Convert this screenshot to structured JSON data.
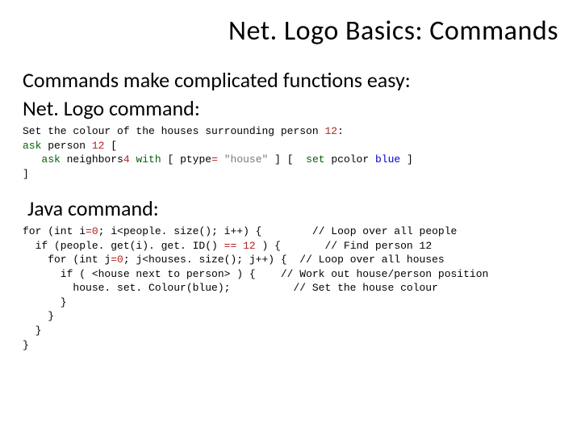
{
  "title": "Net. Logo Basics: Commands",
  "intro_line1": "Commands make complicated functions easy:",
  "intro_line2": " Net. Logo command:",
  "netlogo": {
    "l1_a": "Set the colour of the houses surrounding person ",
    "l1_num": "12",
    "l1_b": ":",
    "l2_a": "ask",
    "l2_b": " person ",
    "l2_num": "12",
    "l2_c": " [",
    "l3_a": "   ",
    "l3_ask": "ask",
    "l3_b": " neighbors",
    "l3_num4": "4",
    "l3_c": " ",
    "l3_with": "with",
    "l3_d": " [ ptype",
    "l3_eq": "=",
    "l3_e": " ",
    "l3_str": "\"house\"",
    "l3_f": " ] [  ",
    "l3_set": "set",
    "l3_g": " pcolor ",
    "l3_blue": "blue",
    "l3_h": " ]",
    "l4": "]"
  },
  "java_label": "Java command:",
  "java": {
    "l1_a": "for (int i",
    "l1_eq": "=",
    "l1_z": "0",
    "l1_b": "; i<people. size(); i++) {        ",
    "c1": "// Loop over all people",
    "l2_a": "  if (people. get(i). get. ID() ",
    "l2_eq": "==",
    "l2_b": " ",
    "l2_n": "12",
    "l2_c": " ) {       ",
    "c2": "// Find person 12",
    "l3_a": "    for (int j",
    "l3_eq": "=",
    "l3_z": "0",
    "l3_b": "; j<houses. size(); j++) {  ",
    "c3": "// Loop over all houses",
    "l4_a": "      if ( <house next to person> ) {    ",
    "c4": "// Work out house/person position",
    "l5_a": "        house. set. Colour(blue);          ",
    "c5": "// Set the house colour",
    "l6": "      }",
    "l7": "    }",
    "l8": "  }",
    "l9": "}"
  }
}
